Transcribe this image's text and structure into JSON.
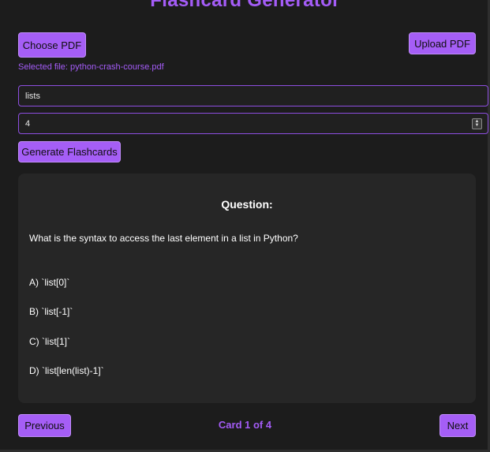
{
  "app": {
    "title": "Flashcard Generator"
  },
  "upload": {
    "choose_label": "Choose PDF",
    "upload_label": "Upload PDF",
    "selected_file_text": "Selected file: python-crash-course.pdf"
  },
  "form": {
    "topic_value": "lists",
    "count_value": "4",
    "generate_label": "Generate Flashcards"
  },
  "card": {
    "heading": "Question:",
    "question": "What is the syntax to access the last element in a list in Python?",
    "options": [
      "A) `list[0]`",
      "B) `list[-1]`",
      "C) `list[1]`",
      "D) `list[len(list)-1]`"
    ]
  },
  "pagination": {
    "previous_label": "Previous",
    "next_label": "Next",
    "counter_text": "Card 1 of 4"
  },
  "colors": {
    "accent": "#a55ef6",
    "background": "#1c1c1c",
    "card_background": "#262626"
  }
}
